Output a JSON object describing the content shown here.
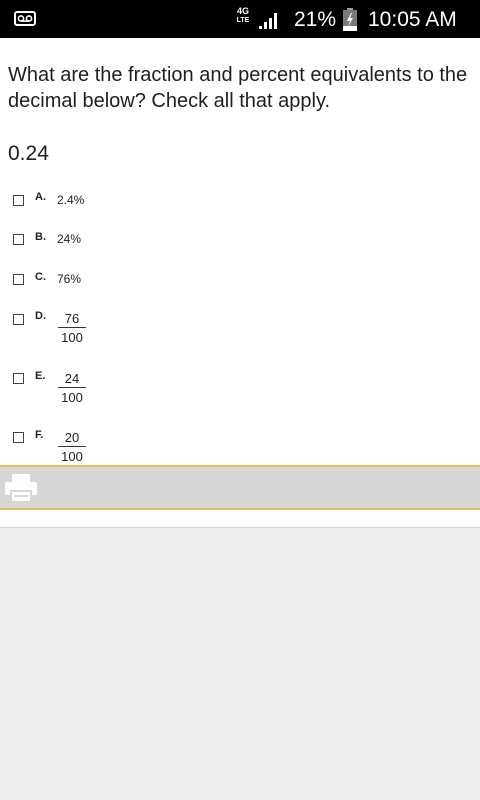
{
  "status_bar": {
    "network": [
      "4G",
      "LTE"
    ],
    "battery": "21%",
    "time": "10:05 AM"
  },
  "question": {
    "prompt": "What are the fraction and percent equivalents to the decimal below? Check all that apply.",
    "value": "0.24"
  },
  "options": [
    {
      "letter": "A.",
      "text": "2.4%"
    },
    {
      "letter": "B.",
      "text": "24%"
    },
    {
      "letter": "C.",
      "text": "76%"
    },
    {
      "letter": "D.",
      "numerator": "76",
      "denominator": "100"
    },
    {
      "letter": "E.",
      "numerator": "24",
      "denominator": "100"
    },
    {
      "letter": "F.",
      "numerator": "20",
      "denominator": "100"
    }
  ],
  "icons": {
    "voicemail": "voicemail-icon",
    "signal": "signal-icon",
    "battery": "battery-icon",
    "print": "print-icon"
  },
  "colors": {
    "toolbar_border": "#e6be5a",
    "toolbar_bg": "#d7d7d7",
    "page_bg": "#ececec"
  }
}
